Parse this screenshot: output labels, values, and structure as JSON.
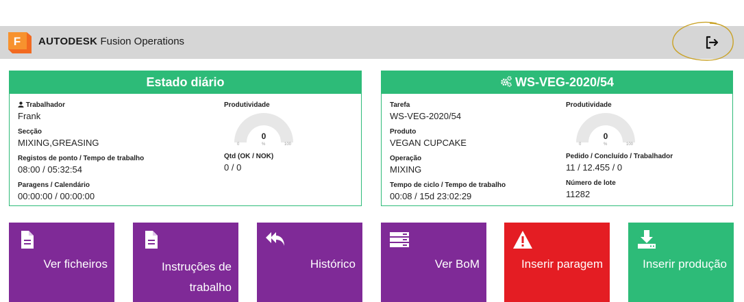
{
  "header": {
    "brand_bold": "AUTODESK",
    "brand_rest": "Fusion Operations",
    "logo_letter": "F",
    "logout_icon": "logout-icon"
  },
  "daily": {
    "title": "Estado diário",
    "worker_label": "Trabalhador",
    "worker_value": "Frank",
    "section_label": "Secção",
    "section_value": "MIXING,GREASING",
    "clock_label": "Registos de ponto / Tempo de trabalho",
    "clock_value": "08:00 / 05:32:54",
    "stops_label": "Paragens / Calendário",
    "stops_value": "00:00:00 / 00:00:00",
    "productivity_label": "Produtividade",
    "gauge_value": "0",
    "gauge_min": "0",
    "gauge_unit": "%",
    "gauge_max": "100",
    "qty_label": "Qtd (OK / NOK)",
    "qty_value": "0 / 0"
  },
  "job": {
    "title": "WS-VEG-2020/54",
    "task_label": "Tarefa",
    "task_value": "WS-VEG-2020/54",
    "product_label": "Produto",
    "product_value": "VEGAN CUPCAKE",
    "operation_label": "Operação",
    "operation_value": "MIXING",
    "cycle_label": "Tempo de ciclo / Tempo de trabalho",
    "cycle_value": "00:08 / 15d 23:02:29",
    "productivity_label": "Produtividade",
    "gauge_value": "0",
    "gauge_min": "0",
    "gauge_unit": "%",
    "gauge_max": "100",
    "order_label": "Pedido / Concluído / Trabalhador",
    "order_value": "11 / 12.455 / 0",
    "lot_label": "Número de lote",
    "lot_value": "11282"
  },
  "tiles": [
    {
      "label": "Ver ficheiros",
      "icon": "file-icon",
      "color": "#7f2a97"
    },
    {
      "label": "Instruções de trabalho",
      "icon": "file-icon",
      "color": "#7f2a97"
    },
    {
      "label": "Histórico",
      "icon": "reply-all-icon",
      "color": "#7f2a97"
    },
    {
      "label": "Ver BoM",
      "icon": "list-icon",
      "color": "#7f2a97"
    },
    {
      "label": "Inserir paragem",
      "icon": "warning-icon",
      "color": "#e41d23"
    },
    {
      "label": "Inserir produção",
      "icon": "download-icon",
      "color": "#2dbb78"
    }
  ],
  "colors": {
    "accent_green": "#2dbb78",
    "tile_purple": "#7f2a97",
    "tile_red": "#e41d23",
    "header_gray": "#d6d6d6"
  }
}
